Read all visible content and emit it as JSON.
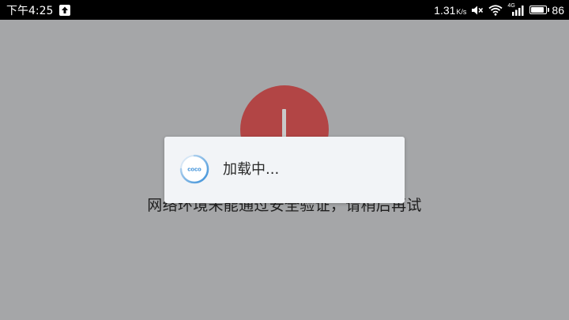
{
  "status_bar": {
    "time": "下午4:25",
    "network_speed": "1.31",
    "speed_unit": "K/s",
    "network_type": "4G",
    "battery_level": "86",
    "battery_fraction": 0.86
  },
  "error_screen": {
    "icon": "error-exclamation-icon",
    "message": "网络环境未能通过安全验证，请稍后再试",
    "circle_color": "#b24545"
  },
  "loading_dialog": {
    "logo_text": "coco",
    "logo_color": "#3a8fd8",
    "text": "加载中..."
  },
  "colors": {
    "overlay_background": "#a5a6a8",
    "status_bar": "#000000",
    "dialog_background": "#f2f4f7"
  }
}
